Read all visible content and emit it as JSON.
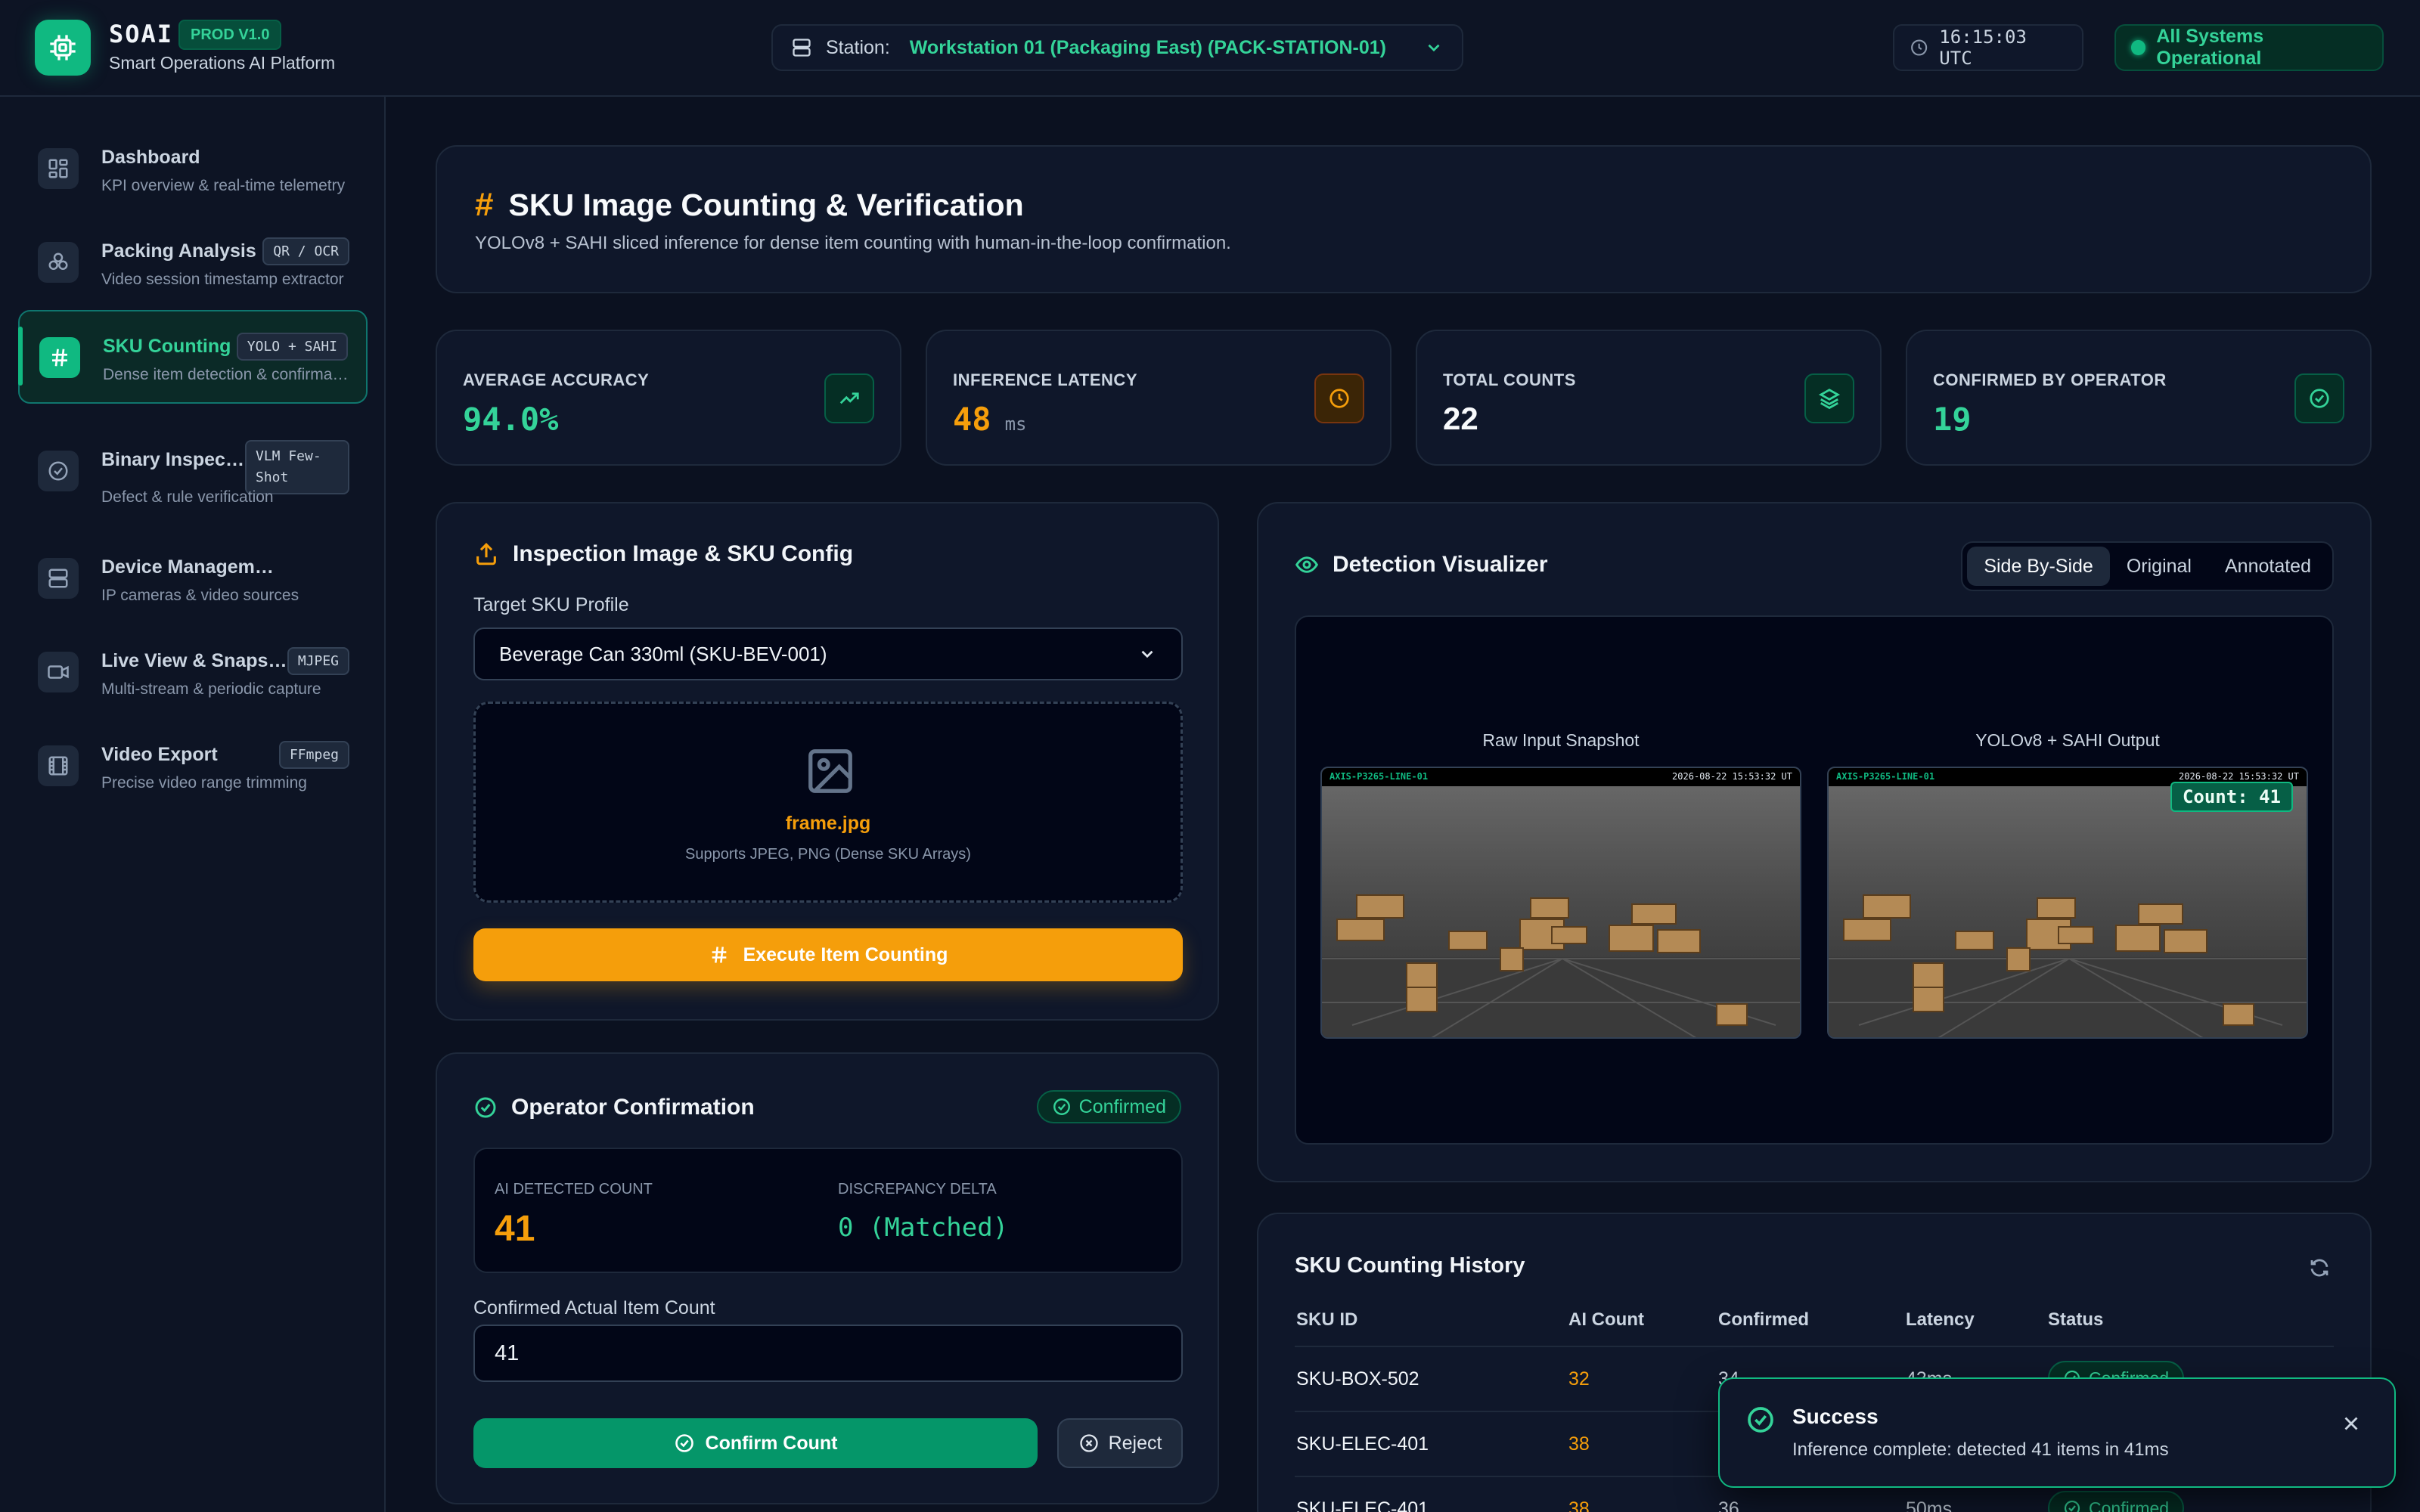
{
  "app": {
    "name": "SOAI",
    "badge": "PROD V1.0",
    "subtitle": "Smart Operations AI Platform",
    "accent": "#10b981",
    "warning": "#f59e0b"
  },
  "topbar": {
    "station_label": "Station:",
    "station_value": "Workstation 01 (Packaging East) (PACK-STATION-01)",
    "clock": "16:15:03 UTC",
    "system_status": "All Systems Operational"
  },
  "sidebar": {
    "items": [
      {
        "title": "Dashboard",
        "desc": "KPI overview & real-time telemetry",
        "tag": "",
        "icon": "grid-icon"
      },
      {
        "title": "Packing Analysis",
        "desc": "Video session timestamp extractor",
        "tag": "QR / OCR",
        "icon": "boxes-icon"
      },
      {
        "title": "SKU Counting",
        "desc": "Dense item detection & confirmation",
        "tag": "YOLO + SAHI",
        "icon": "hash-icon"
      },
      {
        "title": "Binary Inspection",
        "desc": "Defect & rule verification",
        "tag": "VLM Few-Shot",
        "icon": "check-circle-icon"
      },
      {
        "title": "Device Management",
        "desc": "IP cameras & video sources",
        "tag": "",
        "icon": "server-icon"
      },
      {
        "title": "Live View & Snapshots",
        "desc": "Multi-stream & periodic capture",
        "tag": "MJPEG",
        "icon": "camera-icon"
      },
      {
        "title": "Video Export",
        "desc": "Precise video range trimming",
        "tag": "FFmpeg",
        "icon": "film-icon"
      }
    ]
  },
  "header": {
    "title": "SKU Image Counting & Verification",
    "subtitle": "YOLOv8 + SAHI sliced inference for dense item counting with human-in-the-loop confirmation."
  },
  "kpis": [
    {
      "label": "AVERAGE ACCURACY",
      "value": "94.0%",
      "unit": "",
      "color": "#34d399",
      "icon": "trending-up-icon"
    },
    {
      "label": "INFERENCE LATENCY",
      "value": "48",
      "unit": "ms",
      "color": "#f59e0b",
      "icon": "clock-icon"
    },
    {
      "label": "TOTAL COUNTS",
      "value": "22",
      "unit": "",
      "color": "#f8fafc",
      "icon": "layers-icon"
    },
    {
      "label": "CONFIRMED BY OPERATOR",
      "value": "19",
      "unit": "",
      "color": "#34d399",
      "icon": "check-circle-icon"
    }
  ],
  "inspection": {
    "title": "Inspection Image & SKU Config",
    "profile_label": "Target SKU Profile",
    "profile_value": "Beverage Can 330ml (SKU-BEV-001)",
    "file_name": "frame.jpg",
    "file_hint": "Supports JPEG, PNG (Dense SKU Arrays)",
    "run_button": "Execute Item Counting"
  },
  "confirmation": {
    "title": "Operator Confirmation",
    "status": "Confirmed",
    "ai_label": "AI DETECTED COUNT",
    "ai_value": "41",
    "delta_label": "DISCREPANCY DELTA",
    "delta_value": "0 (Matched)",
    "input_label": "Confirmed Actual Item Count",
    "input_value": "41",
    "confirm_button": "Confirm Count",
    "reject_button": "Reject"
  },
  "visualizer": {
    "title": "Detection Visualizer",
    "modes": [
      "Side By-Side",
      "Original",
      "Annotated"
    ],
    "active_mode": 0,
    "left_caption": "Raw Input Snapshot",
    "right_caption": "YOLOv8 + SAHI Output",
    "camera_id": "AXIS-P3265-LINE-01",
    "timestamp": "2026-08-22 15:53:32 UT",
    "count_label": "Count: 41"
  },
  "history": {
    "title": "SKU Counting History",
    "columns": [
      "SKU ID",
      "AI Count",
      "Confirmed",
      "Latency",
      "Status"
    ],
    "rows": [
      {
        "sku": "SKU-BOX-502",
        "ai": "32",
        "confirmed": "34",
        "latency": "43ms",
        "status": "Confirmed"
      },
      {
        "sku": "SKU-ELEC-401",
        "ai": "38",
        "confirmed": "",
        "latency": "",
        "status": ""
      },
      {
        "sku": "SKU-ELEC-401",
        "ai": "38",
        "confirmed": "36",
        "latency": "50ms",
        "status": "Confirmed"
      }
    ]
  },
  "toast": {
    "title": "Success",
    "message": "Inference complete: detected 41 items in 41ms"
  }
}
